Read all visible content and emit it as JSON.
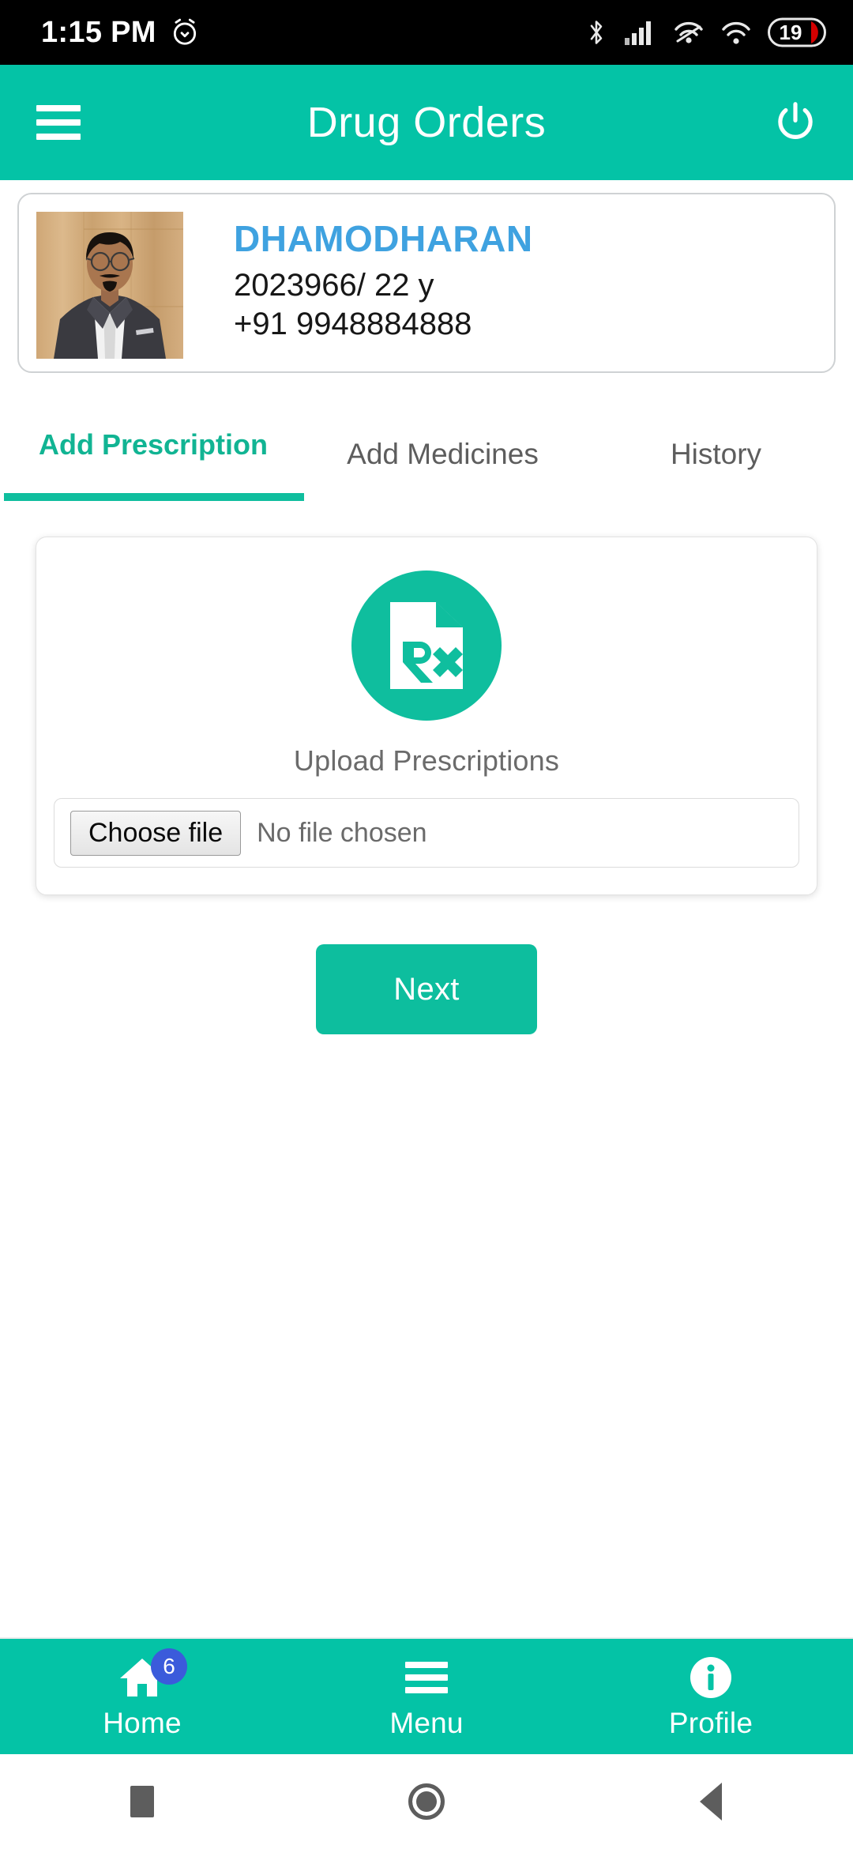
{
  "status_bar": {
    "time": "1:15 PM",
    "alarm_icon": "alarm-icon",
    "bluetooth_icon": "bluetooth-icon",
    "signal_icon": "cellular-signal-icon",
    "hotspot_icon": "wifi-calling-icon",
    "wifi_icon": "wifi-icon",
    "battery_level": "19"
  },
  "app_bar": {
    "title": "Drug Orders",
    "menu_icon": "hamburger-menu-icon",
    "power_icon": "power-logout-icon",
    "background_color": "#04C3A6"
  },
  "patient": {
    "name": "DHAMODHARAN",
    "id_age": "2023966/ 22 y",
    "phone": "+91 9948884888",
    "name_color": "#3FA2E0",
    "photo_alt": "patient-portrait"
  },
  "tabs": [
    {
      "label": "Add Prescription",
      "active": true
    },
    {
      "label": "Add Medicines",
      "active": false
    },
    {
      "label": "History",
      "active": false
    }
  ],
  "upload": {
    "icon": "prescription-rx-icon",
    "label": "Upload Prescriptions",
    "choose_button": "Choose file",
    "file_status": "No file chosen",
    "accent_color": "#0FBE9E"
  },
  "actions": {
    "next_label": "Next"
  },
  "bottom_nav": [
    {
      "label": "Home",
      "icon": "home-icon",
      "badge": "6"
    },
    {
      "label": "Menu",
      "icon": "hamburger-menu-icon",
      "badge": ""
    },
    {
      "label": "Profile",
      "icon": "info-circle-icon",
      "badge": ""
    }
  ],
  "android_nav": {
    "recents": "recents-square-icon",
    "home": "home-circle-icon",
    "back": "back-triangle-icon"
  }
}
